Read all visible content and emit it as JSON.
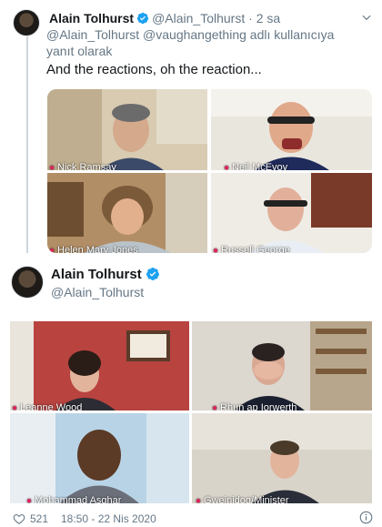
{
  "reply": {
    "name": "Alain Tolhurst",
    "handle": "@Alain_Tolhurst",
    "dot": "·",
    "time": "2 sa",
    "in_reply_to": "@Alain_Tolhurst @vaughangething adlı kullanıcıya yanıt olarak",
    "text": "And the reactions, oh the reaction...",
    "tiles": [
      {
        "label": "Nick Ramsay"
      },
      {
        "label": "Neil McEvoy"
      },
      {
        "label": "Helen Mary Jones"
      },
      {
        "label": "Russell George"
      }
    ]
  },
  "main": {
    "name": "Alain Tolhurst",
    "handle": "@Alain_Tolhurst",
    "tiles": [
      {
        "label": "Leanne Wood"
      },
      {
        "label": "Rhun ap Iorwerth"
      },
      {
        "label": "Mohammad Asghar"
      },
      {
        "label": "Gweinidog/Minister"
      }
    ],
    "likes": "521",
    "timestamp": "18:50 - 22 Nis 2020"
  },
  "icons": {
    "verified": "verified-badge-icon",
    "chevron": "chevron-down-icon",
    "heart": "heart-icon",
    "info": "info-icon"
  },
  "colors": {
    "verified_blue": "#1da1f2",
    "muted": "#657786",
    "text": "#14171a",
    "mic_red": "#e0245e"
  }
}
